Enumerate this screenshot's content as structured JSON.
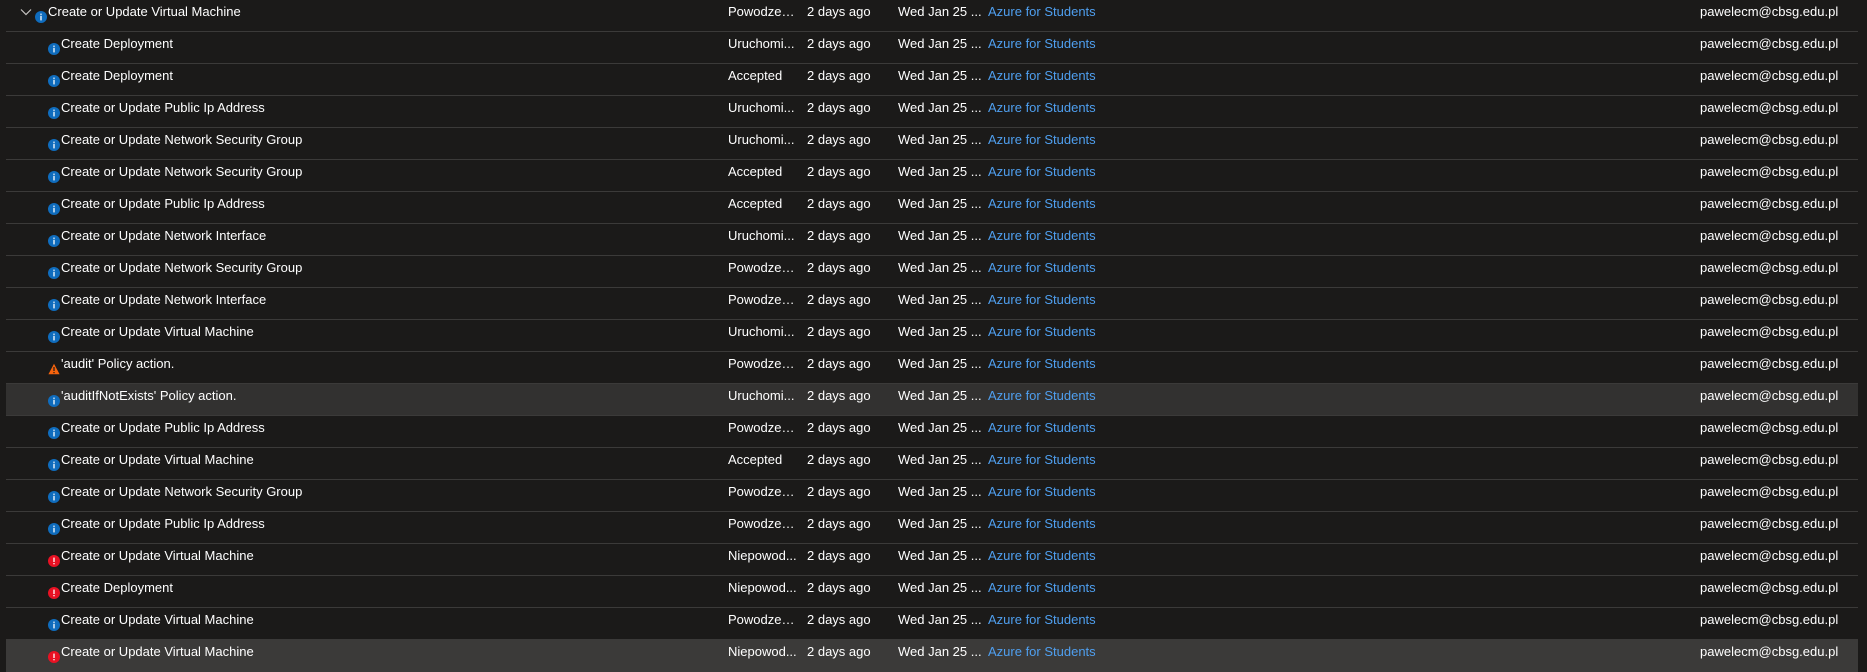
{
  "colors": {
    "background": "#1b1a19",
    "row_border": "#3b3a39",
    "row_selected": "#323130",
    "row_hovered": "#3b3a39",
    "link": "#4f9fef",
    "info_icon": "#0f6cbd",
    "warning_icon": "#f7630c",
    "error_icon": "#e81123"
  },
  "rows": [
    {
      "level": "info",
      "name": "Create or Update Virtual Machine",
      "status": "Powodzenie",
      "time": "2 days ago",
      "date": "Wed Jan 25 ...",
      "subscription": "Azure for Students",
      "user": "pawelecm@cbsg.edu.pl",
      "group": true,
      "expanded": true
    },
    {
      "level": "info",
      "name": "Create Deployment",
      "status": "Uruchomi...",
      "time": "2 days ago",
      "date": "Wed Jan 25 ...",
      "subscription": "Azure for Students",
      "user": "pawelecm@cbsg.edu.pl"
    },
    {
      "level": "info",
      "name": "Create Deployment",
      "status": "Accepted",
      "time": "2 days ago",
      "date": "Wed Jan 25 ...",
      "subscription": "Azure for Students",
      "user": "pawelecm@cbsg.edu.pl"
    },
    {
      "level": "info",
      "name": "Create or Update Public Ip Address",
      "status": "Uruchomi...",
      "time": "2 days ago",
      "date": "Wed Jan 25 ...",
      "subscription": "Azure for Students",
      "user": "pawelecm@cbsg.edu.pl"
    },
    {
      "level": "info",
      "name": "Create or Update Network Security Group",
      "status": "Uruchomi...",
      "time": "2 days ago",
      "date": "Wed Jan 25 ...",
      "subscription": "Azure for Students",
      "user": "pawelecm@cbsg.edu.pl"
    },
    {
      "level": "info",
      "name": "Create or Update Network Security Group",
      "status": "Accepted",
      "time": "2 days ago",
      "date": "Wed Jan 25 ...",
      "subscription": "Azure for Students",
      "user": "pawelecm@cbsg.edu.pl"
    },
    {
      "level": "info",
      "name": "Create or Update Public Ip Address",
      "status": "Accepted",
      "time": "2 days ago",
      "date": "Wed Jan 25 ...",
      "subscription": "Azure for Students",
      "user": "pawelecm@cbsg.edu.pl"
    },
    {
      "level": "info",
      "name": "Create or Update Network Interface",
      "status": "Uruchomi...",
      "time": "2 days ago",
      "date": "Wed Jan 25 ...",
      "subscription": "Azure for Students",
      "user": "pawelecm@cbsg.edu.pl"
    },
    {
      "level": "info",
      "name": "Create or Update Network Security Group",
      "status": "Powodzenie",
      "time": "2 days ago",
      "date": "Wed Jan 25 ...",
      "subscription": "Azure for Students",
      "user": "pawelecm@cbsg.edu.pl"
    },
    {
      "level": "info",
      "name": "Create or Update Network Interface",
      "status": "Powodzenie",
      "time": "2 days ago",
      "date": "Wed Jan 25 ...",
      "subscription": "Azure for Students",
      "user": "pawelecm@cbsg.edu.pl"
    },
    {
      "level": "info",
      "name": "Create or Update Virtual Machine",
      "status": "Uruchomi...",
      "time": "2 days ago",
      "date": "Wed Jan 25 ...",
      "subscription": "Azure for Students",
      "user": "pawelecm@cbsg.edu.pl"
    },
    {
      "level": "warning",
      "name": "'audit' Policy action.",
      "status": "Powodzenie",
      "time": "2 days ago",
      "date": "Wed Jan 25 ...",
      "subscription": "Azure for Students",
      "user": "pawelecm@cbsg.edu.pl"
    },
    {
      "level": "info",
      "name": "'auditIfNotExists' Policy action.",
      "status": "Uruchomi...",
      "time": "2 days ago",
      "date": "Wed Jan 25 ...",
      "subscription": "Azure for Students",
      "user": "pawelecm@cbsg.edu.pl",
      "state": "selected"
    },
    {
      "level": "info",
      "name": "Create or Update Public Ip Address",
      "status": "Powodzenie",
      "time": "2 days ago",
      "date": "Wed Jan 25 ...",
      "subscription": "Azure for Students",
      "user": "pawelecm@cbsg.edu.pl"
    },
    {
      "level": "info",
      "name": "Create or Update Virtual Machine",
      "status": "Accepted",
      "time": "2 days ago",
      "date": "Wed Jan 25 ...",
      "subscription": "Azure for Students",
      "user": "pawelecm@cbsg.edu.pl"
    },
    {
      "level": "info",
      "name": "Create or Update Network Security Group",
      "status": "Powodzenie",
      "time": "2 days ago",
      "date": "Wed Jan 25 ...",
      "subscription": "Azure for Students",
      "user": "pawelecm@cbsg.edu.pl"
    },
    {
      "level": "info",
      "name": "Create or Update Public Ip Address",
      "status": "Powodzenie",
      "time": "2 days ago",
      "date": "Wed Jan 25 ...",
      "subscription": "Azure for Students",
      "user": "pawelecm@cbsg.edu.pl"
    },
    {
      "level": "error",
      "name": "Create or Update Virtual Machine",
      "status": "Niepowod...",
      "time": "2 days ago",
      "date": "Wed Jan 25 ...",
      "subscription": "Azure for Students",
      "user": "pawelecm@cbsg.edu.pl"
    },
    {
      "level": "error",
      "name": "Create Deployment",
      "status": "Niepowod...",
      "time": "2 days ago",
      "date": "Wed Jan 25 ...",
      "subscription": "Azure for Students",
      "user": "pawelecm@cbsg.edu.pl"
    },
    {
      "level": "info",
      "name": "Create or Update Virtual Machine",
      "status": "Powodzenie",
      "time": "2 days ago",
      "date": "Wed Jan 25 ...",
      "subscription": "Azure for Students",
      "user": "pawelecm@cbsg.edu.pl"
    },
    {
      "level": "error",
      "name": "Create or Update Virtual Machine",
      "status": "Niepowod...",
      "time": "2 days ago",
      "date": "Wed Jan 25 ...",
      "subscription": "Azure for Students",
      "user": "pawelecm@cbsg.edu.pl",
      "state": "hovered"
    }
  ]
}
